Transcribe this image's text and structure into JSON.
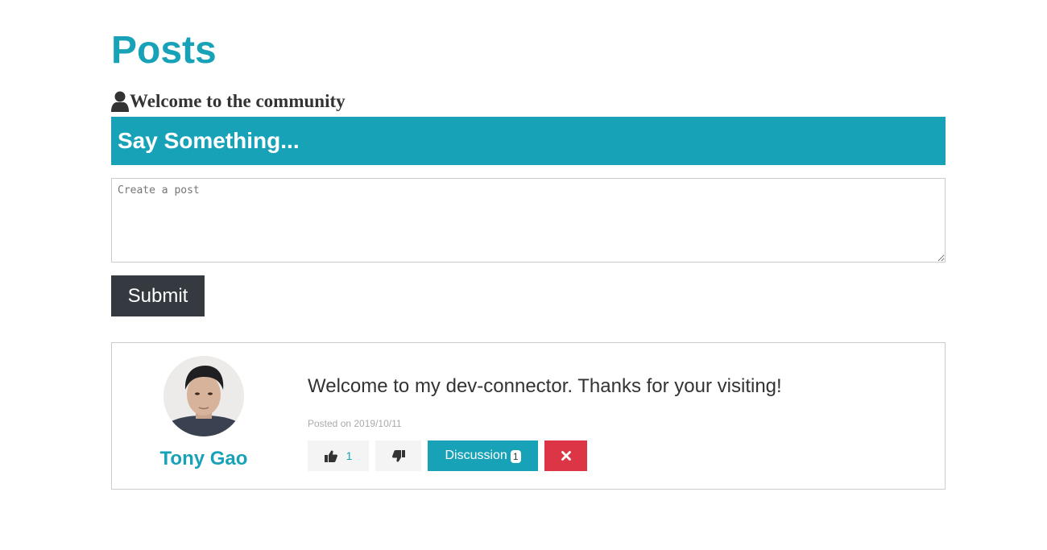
{
  "page": {
    "title": "Posts",
    "welcome": "Welcome to the community",
    "user_icon": "user-icon"
  },
  "post_form": {
    "header": "Say Something...",
    "placeholder": "Create a post",
    "value": "",
    "submit_label": "Submit"
  },
  "posts": [
    {
      "author": "Tony Gao",
      "text": "Welcome to my dev-connector. Thanks for your visiting!",
      "date": "Posted on 2019/10/11",
      "likes": "1",
      "discussion_label": "Discussion",
      "comments": "1",
      "like_icon": "thumbs-up-icon",
      "unlike_icon": "thumbs-down-icon",
      "delete_icon": "close-icon"
    }
  ],
  "colors": {
    "primary": "#17a2b8",
    "dark": "#343a40",
    "danger": "#dc3545",
    "light": "#f4f4f4"
  }
}
